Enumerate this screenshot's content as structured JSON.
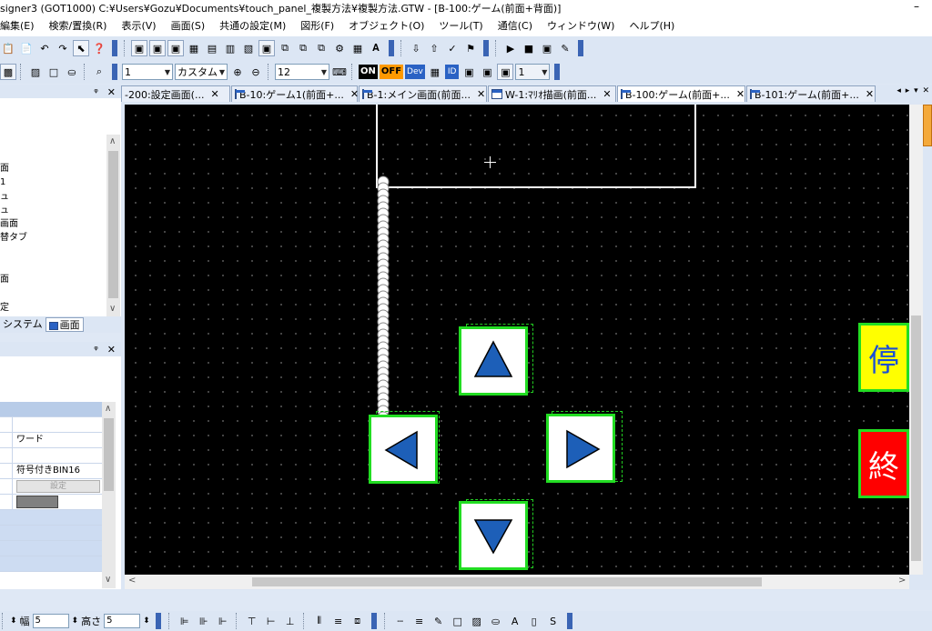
{
  "window": {
    "title": "signer3 (GOT1000) C:¥Users¥Gozu¥Documents¥touch_panel_複製方法¥複製方法.GTW - [B-100:ゲーム(前面+背面)]",
    "minimize_glyph": "–"
  },
  "menu": [
    "編集(E)",
    "検索/置換(R)",
    "表示(V)",
    "画面(S)",
    "共通の設定(M)",
    "図形(F)",
    "オブジェクト(O)",
    "ツール(T)",
    "通信(C)",
    "ウィンドウ(W)",
    "ヘルプ(H)"
  ],
  "toolbar2": {
    "line_width_value": "1",
    "font_value": "カスタム",
    "font_size_value": "12",
    "on_label": "ON",
    "off_label": "OFF",
    "dev_label": "Dev",
    "id_label": "ID",
    "layer_value": "1"
  },
  "left_panel": {
    "pin_glyph": "ᵠ",
    "close_glyph": "✕",
    "tree_items": [
      "面",
      "1",
      "ュ",
      "ュ",
      "画面",
      "替タブ",
      "",
      "面",
      "",
      "定"
    ],
    "tabs": [
      "システム",
      "画面"
    ]
  },
  "properties": {
    "rows": [
      "",
      "ワード",
      "",
      "符号付きBIN16",
      "設定",
      ""
    ],
    "set_label": "設定"
  },
  "tabs": [
    {
      "label": "-200:設定画面(...",
      "close": "✕"
    },
    {
      "label": "B-10:ゲーム1(前面+...",
      "close": "✕"
    },
    {
      "label": "B-1:メイン画面(前面...",
      "close": "✕"
    },
    {
      "label": "W-1:ﾏﾘｵ描画(前面...",
      "close": "✕"
    },
    {
      "label": "B-100:ゲーム(前面+...",
      "close": "✕"
    },
    {
      "label": "B-101:ゲーム(前面+...",
      "close": "✕"
    }
  ],
  "tab_nav": "◂ ▸ ▾ ✕",
  "canvas": {
    "right_buttons": [
      {
        "char": "停",
        "bg": "#ffff00",
        "fg": "#1a4fd6"
      },
      {
        "char": "終",
        "bg": "#ff0000",
        "fg": "#ffffff"
      }
    ],
    "switch_colors": {
      "border": "#22dd22",
      "arrow_fill": "#1d5fb8"
    }
  },
  "bottombar": {
    "width_label": "幅",
    "width_value": "5",
    "height_label": "高さ",
    "height_value": "5"
  }
}
